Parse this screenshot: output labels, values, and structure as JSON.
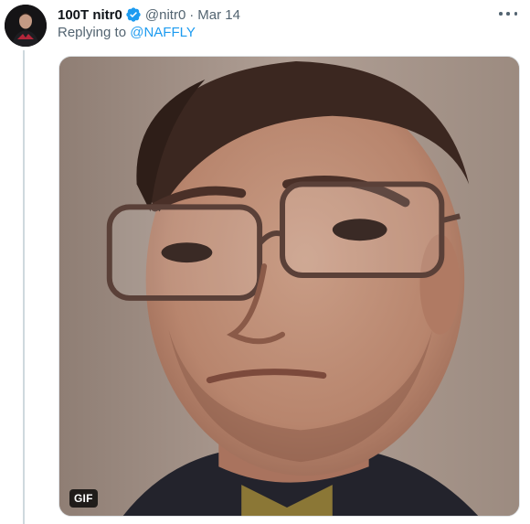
{
  "tweet": {
    "display_name": "100T nitr0",
    "handle": "@nitr0",
    "separator": "·",
    "date": "Mar 14",
    "replying_prefix": "Replying to ",
    "replying_to": "@NAFFLY",
    "media": {
      "type_badge": "GIF"
    }
  },
  "icons": {
    "verified": "verified-badge-icon",
    "more": "more-options-icon"
  },
  "colors": {
    "text_primary": "#0f1419",
    "text_secondary": "#536471",
    "accent": "#1d9bf0",
    "thread_line": "#cfd9de"
  }
}
